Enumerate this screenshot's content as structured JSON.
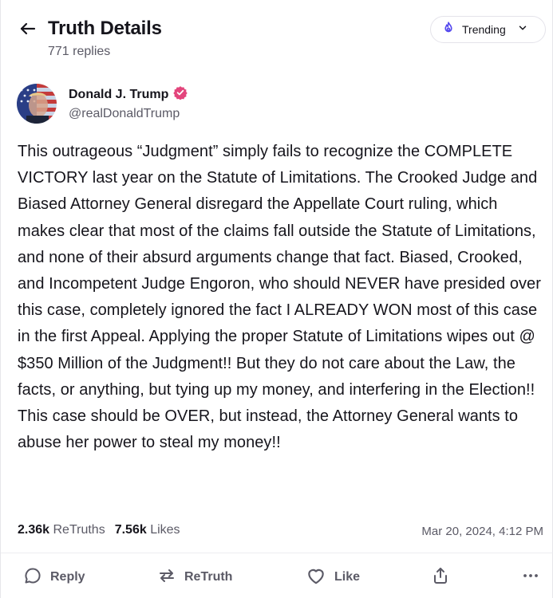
{
  "header": {
    "title": "Truth Details",
    "reply_count": "771 replies",
    "back_icon": "arrow-left-icon",
    "filter": {
      "label": "Trending",
      "icon": "trending-flame-icon"
    }
  },
  "author": {
    "name": "Donald J. Trump",
    "handle": "@realDonaldTrump",
    "verified": true,
    "avatar_icon": "avatar-image"
  },
  "post": {
    "text": "This outrageous “Judgment” simply fails to recognize the COMPLETE VICTORY last year on the Statute of Limitations. The Crooked Judge and Biased Attorney General disregard the Appellate Court ruling, which makes clear that most of the claims fall outside the Statute of Limitations, and none of their absurd arguments change that fact. Biased, Crooked, and Incompetent Judge Engoron, who should NEVER have presided over this case, completely ignored the fact I ALREADY WON most of this case in the first Appeal. Applying the proper Statute of Limitations wipes out @ $350 Million of the Judgment!! But they do not care about the Law, the facts, or anything, but tying up my money, and interfering in the Election!! This case should be OVER, but instead, the Attorney General wants to abuse her power to steal my money!!",
    "retruths_count": "2.36k",
    "retruths_label": "ReTruths",
    "likes_count": "7.56k",
    "likes_label": "Likes",
    "timestamp": "Mar 20, 2024, 4:12 PM"
  },
  "actions": {
    "reply": "Reply",
    "retruth": "ReTruth",
    "like": "Like"
  },
  "colors": {
    "accent": "#5448ee",
    "verified": "#e3457c",
    "text": "#16151c",
    "muted": "#5b5a66"
  }
}
